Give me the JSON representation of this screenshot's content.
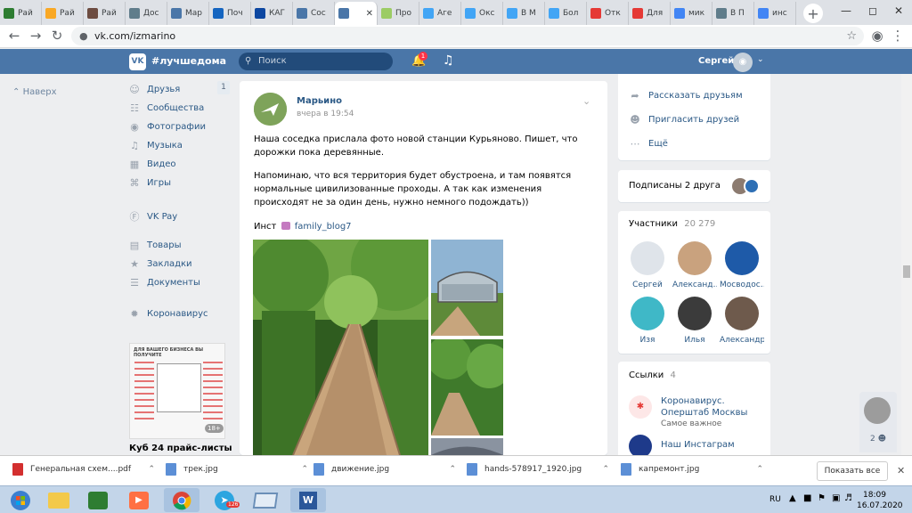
{
  "browser": {
    "tabs": [
      {
        "title": "Рай",
        "color": "#2e7d32"
      },
      {
        "title": "Рай",
        "color": "#f9a825"
      },
      {
        "title": "Рай",
        "color": "#6d4c41"
      },
      {
        "title": "Дос",
        "color": "#607d8b"
      },
      {
        "title": "Мар",
        "color": "#4a76a8"
      },
      {
        "title": "Поч",
        "color": "#1565c0"
      },
      {
        "title": "КАГ",
        "color": "#0d47a1"
      },
      {
        "title": "Coc",
        "color": "#4a76a8"
      },
      {
        "title": "",
        "color": "#4a76a8",
        "active": true
      },
      {
        "title": "Про",
        "color": "#9ccc65"
      },
      {
        "title": "Аге",
        "color": "#42a5f5"
      },
      {
        "title": "Окс",
        "color": "#42a5f5"
      },
      {
        "title": "В М",
        "color": "#42a5f5"
      },
      {
        "title": "Бол",
        "color": "#42a5f5"
      },
      {
        "title": "Отк",
        "color": "#e53935"
      },
      {
        "title": "Для",
        "color": "#e53935"
      },
      {
        "title": "мик",
        "color": "#4285f4"
      },
      {
        "title": "В П",
        "color": "#607d8b"
      },
      {
        "title": "инс",
        "color": "#4285f4"
      }
    ],
    "url": "vk.com/izmarino"
  },
  "vk_header": {
    "logo": "VK",
    "hashtag": "#лучшедома",
    "search_placeholder": "Поиск",
    "notif_count": "1",
    "user_name": "Сергей"
  },
  "left_nav": {
    "back": "Наверх",
    "items": [
      {
        "label": "Друзья",
        "icon": "person-icon"
      },
      {
        "label": "Сообщества",
        "icon": "group-icon"
      },
      {
        "label": "Фотографии",
        "icon": "camera-icon"
      },
      {
        "label": "Музыка",
        "icon": "music-icon"
      },
      {
        "label": "Видео",
        "icon": "video-icon"
      },
      {
        "label": "Игры",
        "icon": "gamepad-icon"
      },
      {
        "label": "VK Pay",
        "icon": "vkpay-icon"
      },
      {
        "label": "Товары",
        "icon": "bag-icon"
      },
      {
        "label": "Закладки",
        "icon": "star-icon"
      },
      {
        "label": "Документы",
        "icon": "document-icon"
      },
      {
        "label": "Коронавирус",
        "icon": "virus-icon"
      }
    ],
    "friends_count": "1",
    "ad_header": "ДЛЯ ВАШЕГО БИЗНЕСА ВЫ ПОЛУЧИТЕ",
    "ad_badge": "18+",
    "ad_title": "Куб 24 прайс-листы"
  },
  "post": {
    "author": "Марьино",
    "time": "вчера в 19:54",
    "paragraph1": "Наша соседка прислала фото новой станции Курьяново. Пишет, что дорожки пока деревянные.",
    "paragraph2": "Напоминаю, что вся территория будет обустроена, и там появятся нормальные цивилизованные проходы. А так как изменения происходят не за один день, нужно немного подождать))",
    "inst_prefix": "Инст",
    "inst_tag": "family_blog7"
  },
  "right": {
    "actions": [
      {
        "label": "Рассказать друзьям",
        "icon": "share-icon"
      },
      {
        "label": "Пригласить друзей",
        "icon": "add-user-icon"
      },
      {
        "label": "Ещё",
        "icon": "more-icon"
      }
    ],
    "subscribed": "Подписаны 2 друга",
    "members_title": "Участники",
    "members_count": "20 279",
    "members": [
      {
        "name": "Сергей",
        "color": "#dfe4ea"
      },
      {
        "name": "Александ…",
        "color": "#c9a27e"
      },
      {
        "name": "Мосводос…",
        "color": "#1e5aa8"
      },
      {
        "name": "Изя",
        "color": "#3fb8c7"
      },
      {
        "name": "Илья",
        "color": "#3b3b3b"
      },
      {
        "name": "Александр",
        "color": "#6e5a4c"
      }
    ],
    "links_title": "Ссылки",
    "links_count": "4",
    "links": [
      {
        "title": "Коронавирус. Оперштаб Москвы",
        "sub": "Самое важное"
      },
      {
        "title": "Наш Инстаграм",
        "sub": ""
      }
    ]
  },
  "chat_widget": {
    "count": "2"
  },
  "downloads": {
    "items": [
      {
        "name": "Генеральная схем....pdf",
        "color": "#d32f2f"
      },
      {
        "name": "трек.jpg",
        "color": "#5c8fd6"
      },
      {
        "name": "движение.jpg",
        "color": "#5c8fd6"
      },
      {
        "name": "hands-578917_1920.jpg",
        "color": "#5c8fd6"
      },
      {
        "name": "капремонт.jpg",
        "color": "#5c8fd6"
      }
    ],
    "show_all": "Показать все"
  },
  "taskbar": {
    "telegram_badge": "126",
    "word_label": "W",
    "lang": "RU",
    "time": "18:09",
    "date": "16.07.2020"
  }
}
